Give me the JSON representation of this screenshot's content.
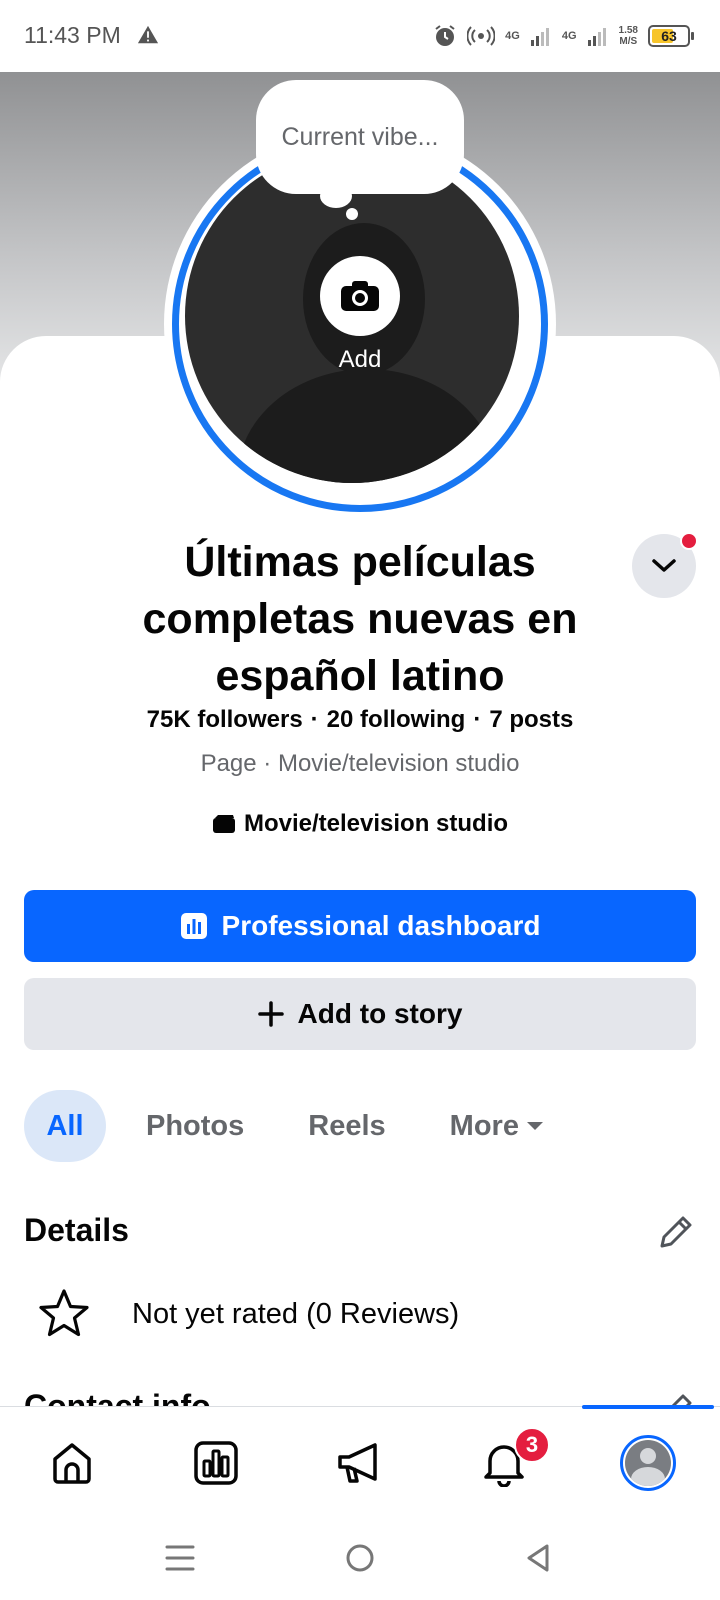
{
  "status_bar": {
    "time": "11:43 PM",
    "network1": "4G",
    "network2": "4G",
    "speed_value": "1.58",
    "speed_unit": "M/S",
    "battery_level": "63",
    "battery_percent": 63,
    "icons": [
      "warning-icon",
      "alarm-icon",
      "hotspot-icon",
      "signal-icon",
      "signal-icon",
      "battery-icon"
    ]
  },
  "profile": {
    "bubble_placeholder": "Current vibe...",
    "add_label": "Add",
    "name": "Últimas películas completas nuevas en español latino",
    "followers": "75K followers",
    "following": "20 following",
    "posts": "7 posts",
    "separator": "·",
    "subtitle": "Page · Movie/television studio",
    "category": "Movie/television studio"
  },
  "actions": {
    "professional_dashboard": "Professional dashboard",
    "add_to_story": "Add to story"
  },
  "tabs": {
    "all": "All",
    "photos": "Photos",
    "reels": "Reels",
    "more": "More"
  },
  "details": {
    "title": "Details",
    "rating": "Not yet rated (0 Reviews)",
    "contact_title": "Contact info"
  },
  "bottom_nav": {
    "notifications_badge": "3",
    "items": [
      "home-icon",
      "dashboard-icon",
      "megaphone-icon",
      "bell-icon",
      "profile-avatar"
    ]
  },
  "colors": {
    "primary": "#0866ff",
    "badge_red": "#e41e3f",
    "secondary_bg": "#e4e6eb",
    "muted_text": "#65676b"
  }
}
